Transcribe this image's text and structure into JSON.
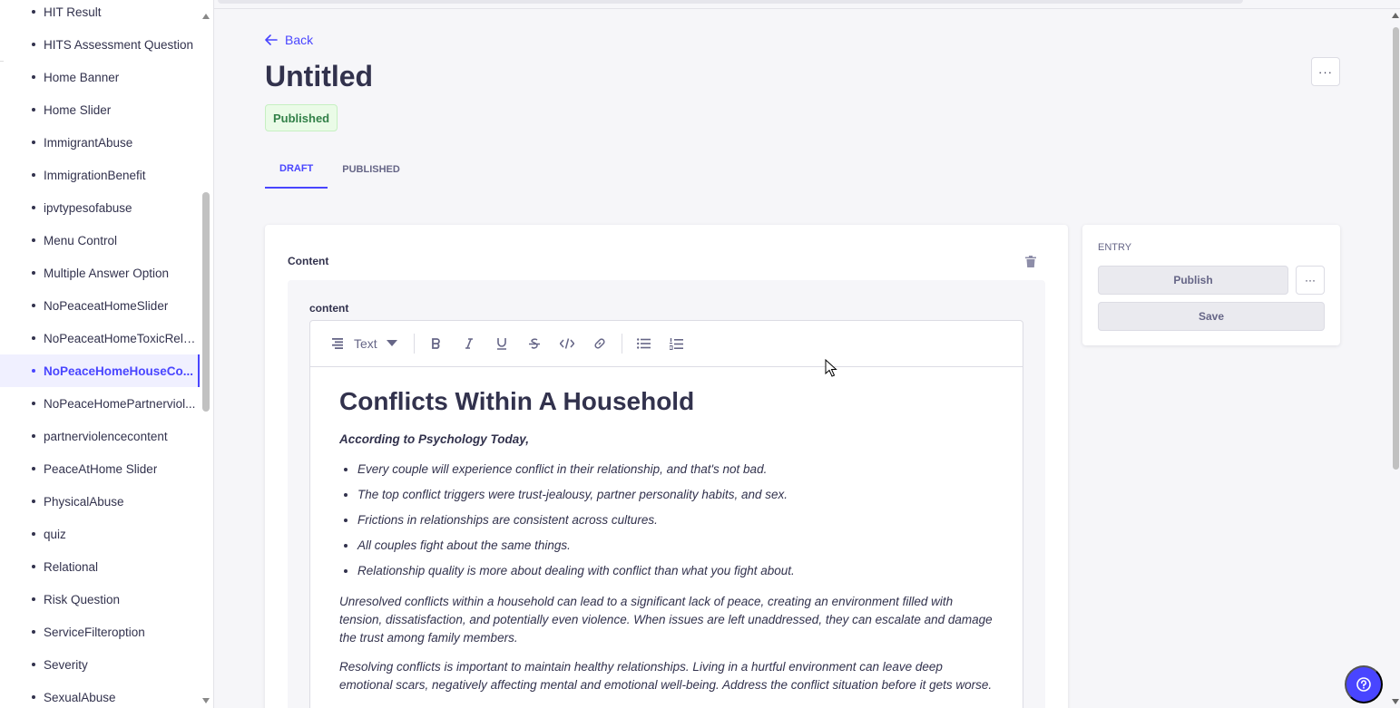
{
  "sidebar": {
    "items": [
      {
        "label": "HIT Result"
      },
      {
        "label": "HITS Assessment Question"
      },
      {
        "label": "Home Banner"
      },
      {
        "label": "Home Slider"
      },
      {
        "label": "ImmigrantAbuse"
      },
      {
        "label": "ImmigrationBenefit"
      },
      {
        "label": "ipvtypesofabuse"
      },
      {
        "label": "Menu Control"
      },
      {
        "label": "Multiple Answer Option"
      },
      {
        "label": "NoPeaceatHomeSlider"
      },
      {
        "label": "NoPeaceatHomeToxicRela..."
      },
      {
        "label": "NoPeaceHomeHouseCo..."
      },
      {
        "label": "NoPeaceHomePartnerviol..."
      },
      {
        "label": "partnerviolencecontent"
      },
      {
        "label": "PeaceAtHome Slider"
      },
      {
        "label": "PhysicalAbuse"
      },
      {
        "label": "quiz"
      },
      {
        "label": "Relational"
      },
      {
        "label": "Risk Question"
      },
      {
        "label": "ServiceFilteroption"
      },
      {
        "label": "Severity"
      },
      {
        "label": "SexualAbuse"
      }
    ],
    "active_index": 11
  },
  "header": {
    "back_label": "Back",
    "title": "Untitled",
    "status_badge": "Published",
    "more_label": "···"
  },
  "tabs": [
    {
      "label": "DRAFT",
      "active": true
    },
    {
      "label": "PUBLISHED",
      "active": false
    }
  ],
  "content_card": {
    "section_label": "Content",
    "field_label": "content",
    "toolbar": {
      "text_style": "Text",
      "icons": [
        "paragraph-icon",
        "bold-icon",
        "italic-icon",
        "underline-icon",
        "strikethrough-icon",
        "code-icon",
        "link-icon",
        "bulleted-list-icon",
        "numbered-list-icon"
      ]
    },
    "body": {
      "heading": "Conflicts Within A Household",
      "lead": "According to Psychology Today,",
      "bullets": [
        "Every couple will experience conflict in their relationship, and that's not bad.",
        "The top conflict triggers were trust-jealousy, partner personality habits, and sex.",
        "Frictions in relationships are consistent across cultures.",
        "All couples fight about the same things.",
        "Relationship quality is more about dealing with conflict than what you fight about."
      ],
      "paragraph1": "Unresolved conflicts within a household can lead to a significant lack of peace, creating an environment filled with tension, dissatisfaction, and potentially even violence. When issues are left unaddressed, they can escalate and damage the trust among family members.",
      "paragraph2": "Resolving conflicts is important to maintain healthy relationships. Living in a hurtful environment can leave deep emotional scars, negatively affecting mental and emotional well-being. Address the conflict situation before it gets worse."
    }
  },
  "entry_panel": {
    "label": "ENTRY",
    "publish_label": "Publish",
    "more_label": "···",
    "save_label": "Save"
  },
  "colors": {
    "primary": "#4945ff",
    "success_bg": "#eafbe7",
    "success_text": "#328048",
    "text": "#32324d",
    "muted": "#666687"
  }
}
